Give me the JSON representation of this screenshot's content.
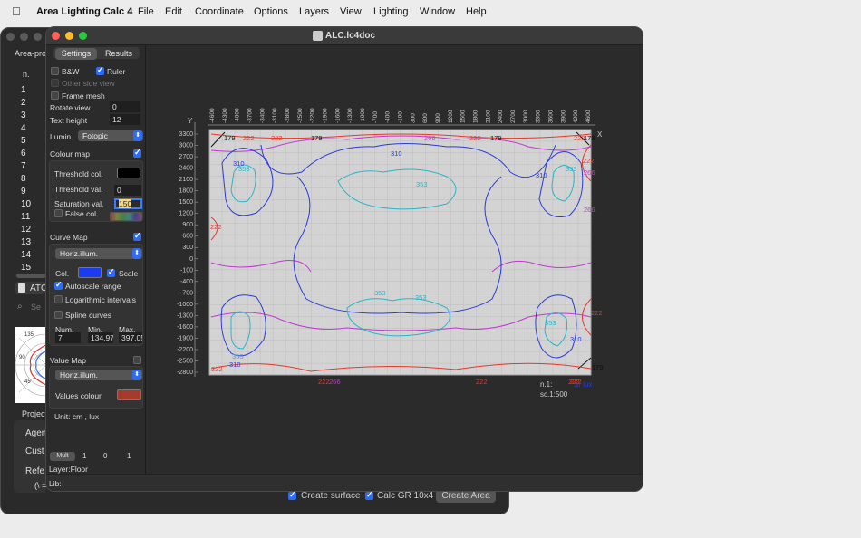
{
  "menubar": {
    "apple": "",
    "app": "Area Lighting Calc 4",
    "items": [
      "File",
      "Edit",
      "Coordinate",
      "Options",
      "Layers",
      "View",
      "Lighting",
      "Window",
      "Help"
    ]
  },
  "back_window": {
    "header": "Area-pro",
    "col_header": "n.",
    "rows": [
      "1",
      "2",
      "3",
      "4",
      "5",
      "6",
      "7",
      "8",
      "9",
      "10",
      "11",
      "12",
      "13",
      "14",
      "15"
    ],
    "atc_label": "ATC",
    "search_placeholder": "Se",
    "polar_ticks": [
      "135",
      "90",
      "45"
    ],
    "project_label": "Project",
    "agent_label": "Agen",
    "cust_label": "Cust",
    "ref_label": "Refe",
    "eq_label": "(\\ =",
    "bottom": {
      "create_surface": "Create surface",
      "calc_gr": "Calc GR 10x4",
      "create_area": "Create Area"
    }
  },
  "main_window": {
    "title": "ALC.lc4doc",
    "tabs": {
      "settings": "Settings",
      "results": "Results"
    },
    "settings": {
      "bw": "B&W",
      "ruler": "Ruler",
      "other_side": "Other side view",
      "frame_mesh": "Frame mesh",
      "rotate_view_label": "Rotate view",
      "rotate_view_value": "0",
      "text_height_label": "Text height",
      "text_height_value": "12",
      "lumin_label": "Lumin.",
      "lumin_value": "Fotopic",
      "colour_map": "Colour map",
      "threshold_col": "Threshold col.",
      "threshold_val_label": "Threshold val.",
      "threshold_val_value": "0",
      "saturation_label": "Saturation val.",
      "saturation_value": "150",
      "false_col": "False col.",
      "curve_map": "Curve Map",
      "curve_select": "Horiz.illum.",
      "col_label": "Col.",
      "scale_label": "Scale",
      "autoscale": "Autoscale range",
      "log_intervals": "Logarithmic intervals",
      "spline": "Spline curves",
      "num_label": "Num.",
      "num_value": "7",
      "min_label": "Min.",
      "min_value": "134,97",
      "max_label": "Max.",
      "max_value": "397,05",
      "value_map": "Value Map",
      "value_select": "Horiz.illum.",
      "values_colour": "Values colour",
      "unit": "Unit:  cm ,  lux",
      "mult": "Mult",
      "mult_vals": [
        "1",
        "0",
        "1"
      ],
      "layer": "Layer:Floor",
      "lib": "Lib:"
    },
    "plot": {
      "y_axis_label": "Y",
      "x_axis_label": "X",
      "y_ticks": [
        "3300",
        "3000",
        "2700",
        "2400",
        "2100",
        "1800",
        "1500",
        "1200",
        "900",
        "600",
        "300",
        "0",
        "-100",
        "-400",
        "-700",
        "-1000",
        "-1300",
        "-1600",
        "-1900",
        "-2200",
        "-2500",
        "-2800"
      ],
      "x_ticks": [
        "-4600",
        "-4300",
        "-4000",
        "-3700",
        "-3400",
        "-3100",
        "-2800",
        "-2500",
        "-2200",
        "-1900",
        "-1600",
        "-1300",
        "-1000",
        "-700",
        "-400",
        "-100",
        "300",
        "600",
        "900",
        "1200",
        "1500",
        "1800",
        "2100",
        "2400",
        "2700",
        "3000",
        "3300",
        "3600",
        "3900",
        "4200",
        "4600"
      ],
      "labels": [
        {
          "t": "179",
          "c": "#111"
        },
        {
          "t": "222",
          "c": "#e8382c"
        },
        {
          "t": "222",
          "c": "#e8382c"
        },
        {
          "t": "179",
          "c": "#111"
        },
        {
          "t": "266",
          "c": "#c03ad0"
        },
        {
          "t": "222",
          "c": "#e8382c"
        },
        {
          "t": "179",
          "c": "#111"
        },
        {
          "t": "222",
          "c": "#e8382c"
        },
        {
          "t": "179",
          "c": "#111"
        },
        {
          "t": "310",
          "c": "#2b3bd6"
        },
        {
          "t": "353",
          "c": "#2ab5c7"
        },
        {
          "t": "310",
          "c": "#2b3bd6"
        },
        {
          "t": "353",
          "c": "#2ab5c7"
        },
        {
          "t": "353",
          "c": "#2ab5c7"
        },
        {
          "t": "310",
          "c": "#2b3bd6"
        },
        {
          "t": "222",
          "c": "#e8382c"
        },
        {
          "t": "266",
          "c": "#c03ad0"
        },
        {
          "t": "222",
          "c": "#e8382c"
        },
        {
          "t": "266",
          "c": "#c03ad0"
        },
        {
          "t": "353",
          "c": "#2ab5c7"
        },
        {
          "t": "353",
          "c": "#2ab5c7"
        },
        {
          "t": "353",
          "c": "#2ab5c7"
        },
        {
          "t": "310",
          "c": "#2b3bd6"
        },
        {
          "t": "222",
          "c": "#e8382c"
        },
        {
          "t": "310",
          "c": "#2b3bd6"
        },
        {
          "t": "353",
          "c": "#2ab5c7"
        },
        {
          "t": "222",
          "c": "#e8382c"
        },
        {
          "t": "222",
          "c": "#e8382c"
        },
        {
          "t": "266",
          "c": "#c03ad0"
        },
        {
          "t": "222",
          "c": "#e8382c"
        },
        {
          "t": "222",
          "c": "#e8382c"
        },
        {
          "t": "179",
          "c": "#111"
        },
        {
          "t": "222",
          "c": "#e8382c"
        }
      ],
      "legend_n": "n.1:",
      "legend_lux": "Sr lux",
      "scale": "sc.1:500"
    }
  },
  "colors": {
    "contour_179": "#111111",
    "contour_222": "#e8382c",
    "contour_266": "#c03ad0",
    "contour_310": "#2b3bd6",
    "contour_353": "#2ab5c7",
    "accent": "#2f6cf2",
    "curve_col": "#1a3cf0",
    "values_colour": "#a83a2c"
  }
}
